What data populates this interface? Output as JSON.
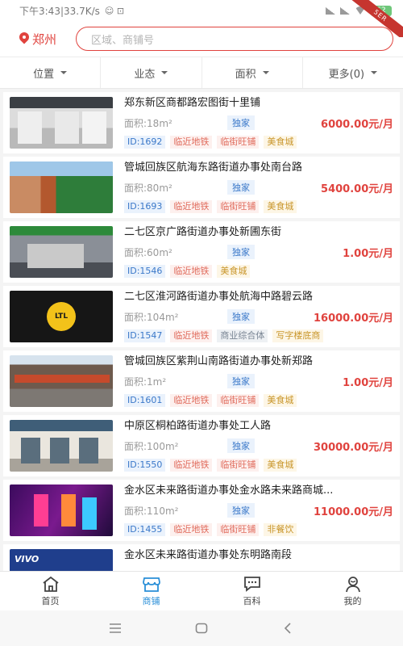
{
  "status_bar": {
    "time_speed": "下午3:43|33.7K/s",
    "battery": "62",
    "ribbon": "5ER"
  },
  "header": {
    "city": "郑州",
    "search_placeholder": "区域、商铺号"
  },
  "filters": [
    {
      "label": "位置"
    },
    {
      "label": "业态"
    },
    {
      "label": "面积"
    },
    {
      "label": "更多(0)"
    }
  ],
  "listings": [
    {
      "title": "郑东新区商都路宏图街十里铺",
      "area": "面积:18m²",
      "exclusive": "独家",
      "price": "6000.00元/月",
      "id": "ID:1692",
      "tags": [
        {
          "text": "临近地铁",
          "style": "red"
        },
        {
          "text": "临街旺铺",
          "style": "red"
        },
        {
          "text": "美食城",
          "style": "yellow"
        }
      ]
    },
    {
      "title": "管城回族区航海东路街道办事处南台路",
      "area": "面积:80m²",
      "exclusive": "独家",
      "price": "5400.00元/月",
      "id": "ID:1693",
      "tags": [
        {
          "text": "临近地铁",
          "style": "red"
        },
        {
          "text": "临街旺铺",
          "style": "red"
        },
        {
          "text": "美食城",
          "style": "yellow"
        }
      ]
    },
    {
      "title": "二七区京广路街道办事处新圃东街",
      "area": "面积:60m²",
      "exclusive": "独家",
      "price": "1.00元/月",
      "id": "ID:1546",
      "tags": [
        {
          "text": "临近地铁",
          "style": "red"
        },
        {
          "text": "美食城",
          "style": "yellow"
        }
      ]
    },
    {
      "title": "二七区淮河路街道办事处航海中路碧云路",
      "area": "面积:104m²",
      "exclusive": "独家",
      "price": "16000.00元/月",
      "id": "ID:1547",
      "thumb_text": "LTL",
      "tags": [
        {
          "text": "临近地铁",
          "style": "red"
        },
        {
          "text": "商业综合体",
          "style": "gray"
        },
        {
          "text": "写字楼底商",
          "style": "yellow"
        }
      ]
    },
    {
      "title": "管城回族区紫荆山南路街道办事处新郑路",
      "area": "面积:1m²",
      "exclusive": "独家",
      "price": "1.00元/月",
      "id": "ID:1601",
      "tags": [
        {
          "text": "临近地铁",
          "style": "red"
        },
        {
          "text": "临街旺铺",
          "style": "red"
        },
        {
          "text": "美食城",
          "style": "yellow"
        }
      ]
    },
    {
      "title": "中原区桐柏路街道办事处工人路",
      "area": "面积:100m²",
      "exclusive": "独家",
      "price": "30000.00元/月",
      "id": "ID:1550",
      "tags": [
        {
          "text": "临近地铁",
          "style": "red"
        },
        {
          "text": "临街旺铺",
          "style": "red"
        },
        {
          "text": "美食城",
          "style": "yellow"
        }
      ]
    },
    {
      "title": "金水区未来路街道办事处金水路未来路商城...",
      "area": "面积:110m²",
      "exclusive": "独家",
      "price": "11000.00元/月",
      "id": "ID:1455",
      "tags": [
        {
          "text": "临近地铁",
          "style": "red"
        },
        {
          "text": "临街旺铺",
          "style": "red"
        },
        {
          "text": "非餐饮",
          "style": "yellow"
        }
      ]
    },
    {
      "title": "金水区未来路街道办事处东明路南段",
      "area": "",
      "exclusive": "",
      "price": "",
      "id": "",
      "thumb_text": "VIVO",
      "tags": []
    }
  ],
  "tab_bar": [
    {
      "label": "首页",
      "icon": "home-icon"
    },
    {
      "label": "商铺",
      "icon": "store-icon"
    },
    {
      "label": "百科",
      "icon": "chat-icon"
    },
    {
      "label": "我的",
      "icon": "user-icon"
    }
  ],
  "colors": {
    "accent": "#e0433e",
    "tab_active": "#2a8fd8"
  }
}
